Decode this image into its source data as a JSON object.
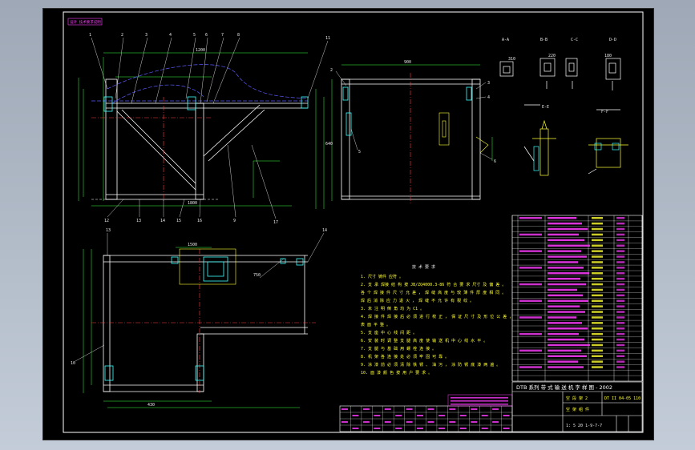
{
  "drawing": {
    "corner_tag": "设计 技术要求说明",
    "title_block": {
      "line1": "DTB 系列    带 式 输 送 机 字 样 图 - 2002",
      "line2a": "空 段 架 2",
      "line2b": "空 架 组 件",
      "line3": "1: 5 20   1-9-7-7",
      "line4": "DT II 04-05 110"
    },
    "notes": {
      "heading": "技 术 要 求",
      "lines": [
        "1. 尺寸 铸件 应符 。",
        "2. 支 承 焊接 结 构 按 JB/ZQ4000.3-86 符 合 要 求 尺寸 及 偏 差 。",
        "   各 个 焊 接 件 尺 寸 允 差 ， 焊 缝 高 度 与 较 薄 件 厚 度 相 同 。",
        "   焊 后 消 除 应 力 退 火 ， 焊 缝 不 允 许 有 裂 纹 。",
        "3. 未 注 明 倒 角 均 为 C1 。",
        "4. 焊 接 件 焊 接 后 必 须 进 行 校 正 ， 保 证 尺 寸 及 形 位 公 差 ，",
        "   表 面 平 整 。",
        "5. 支 座 中 心 线 间 距 。",
        "6. 安 装 时 调 整 支 腿 高 度 使 输 送 机 中 心 线 水 平 。",
        "7. 支 腿 与 基 础 用 螺 栓 连 接 。",
        "8. 机 架 各 连 接 处 必 须 牢 固 可 靠 。",
        "9. 涂 漆 前 必 须 清 除 铁 锈 、 油 污 ， 涂 防 锈 底 漆 两 遍 。",
        "10. 面 漆 颜 色 按 用 户 要 求 。"
      ]
    },
    "section_labels": [
      "A-A",
      "B-B",
      "C-C",
      "D-D",
      "E-E",
      "F-F"
    ],
    "balloons": [
      "1",
      "2",
      "3",
      "4",
      "5",
      "6",
      "7",
      "8",
      "9",
      "10",
      "11",
      "12",
      "13",
      "14",
      "15",
      "16",
      "17"
    ],
    "dimensions": [
      "1200",
      "1800",
      "900",
      "640",
      "750",
      "1500",
      "430",
      "310",
      "220",
      "180"
    ]
  }
}
